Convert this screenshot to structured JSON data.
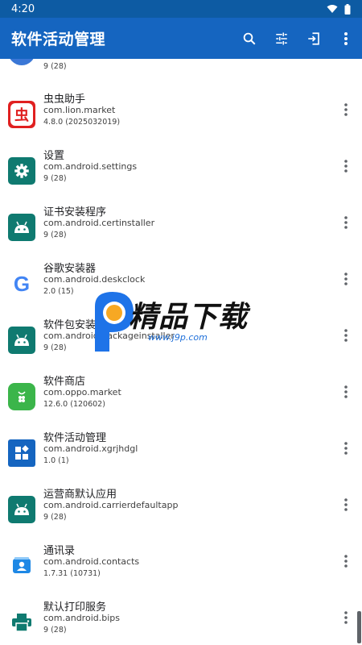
{
  "status_bar": {
    "time": "4:20"
  },
  "app_bar": {
    "title": "软件活动管理",
    "actions": [
      "search-icon",
      "tune-icon",
      "login-icon",
      "more-vert-icon"
    ]
  },
  "partial_top_item": {
    "version": "9 (28)"
  },
  "apps": [
    {
      "name": "虫虫助手",
      "package": "com.lion.market",
      "version": "4.8.0 (2025032019)",
      "icon": "chongchong-icon",
      "icon_text": "虫"
    },
    {
      "name": "设置",
      "package": "com.android.settings",
      "version": "9 (28)",
      "icon": "settings-gear-icon"
    },
    {
      "name": "证书安装程序",
      "package": "com.android.certinstaller",
      "version": "9 (28)",
      "icon": "android-robot-icon"
    },
    {
      "name": "谷歌安装器",
      "package": "com.android.deskclock",
      "version": "2.0 (15)",
      "icon": "google-g-icon",
      "icon_text": "G"
    },
    {
      "name": "软件包安装程序",
      "package": "com.android.packageinstaller",
      "version": "9 (28)",
      "icon": "android-robot-icon"
    },
    {
      "name": "软件商店",
      "package": "com.oppo.market",
      "version": "12.6.0 (120602)",
      "icon": "app-store-bag-icon"
    },
    {
      "name": "软件活动管理",
      "package": "com.android.xgrjhdgl",
      "version": "1.0 (1)",
      "icon": "activity-manager-icon"
    },
    {
      "name": "运营商默认应用",
      "package": "com.android.carrierdefaultapp",
      "version": "9 (28)",
      "icon": "android-robot-icon"
    },
    {
      "name": "通讯录",
      "package": "com.android.contacts",
      "version": "1.7.31 (10731)",
      "icon": "contacts-icon"
    },
    {
      "name": "默认打印服务",
      "package": "com.android.bips",
      "version": "9 (28)",
      "icon": "printer-icon"
    }
  ],
  "watermark": {
    "text": "精品下载",
    "url": "www.j9p.com"
  },
  "colors": {
    "status_bar": "#0d5ba3",
    "app_bar": "#1565c0",
    "android_icon_bg": "#0f7a70",
    "chongchong_red": "#e02020",
    "settings_teal": "#0f7a70",
    "store_green": "#3bb54a",
    "activity_blue": "#1565c0"
  }
}
